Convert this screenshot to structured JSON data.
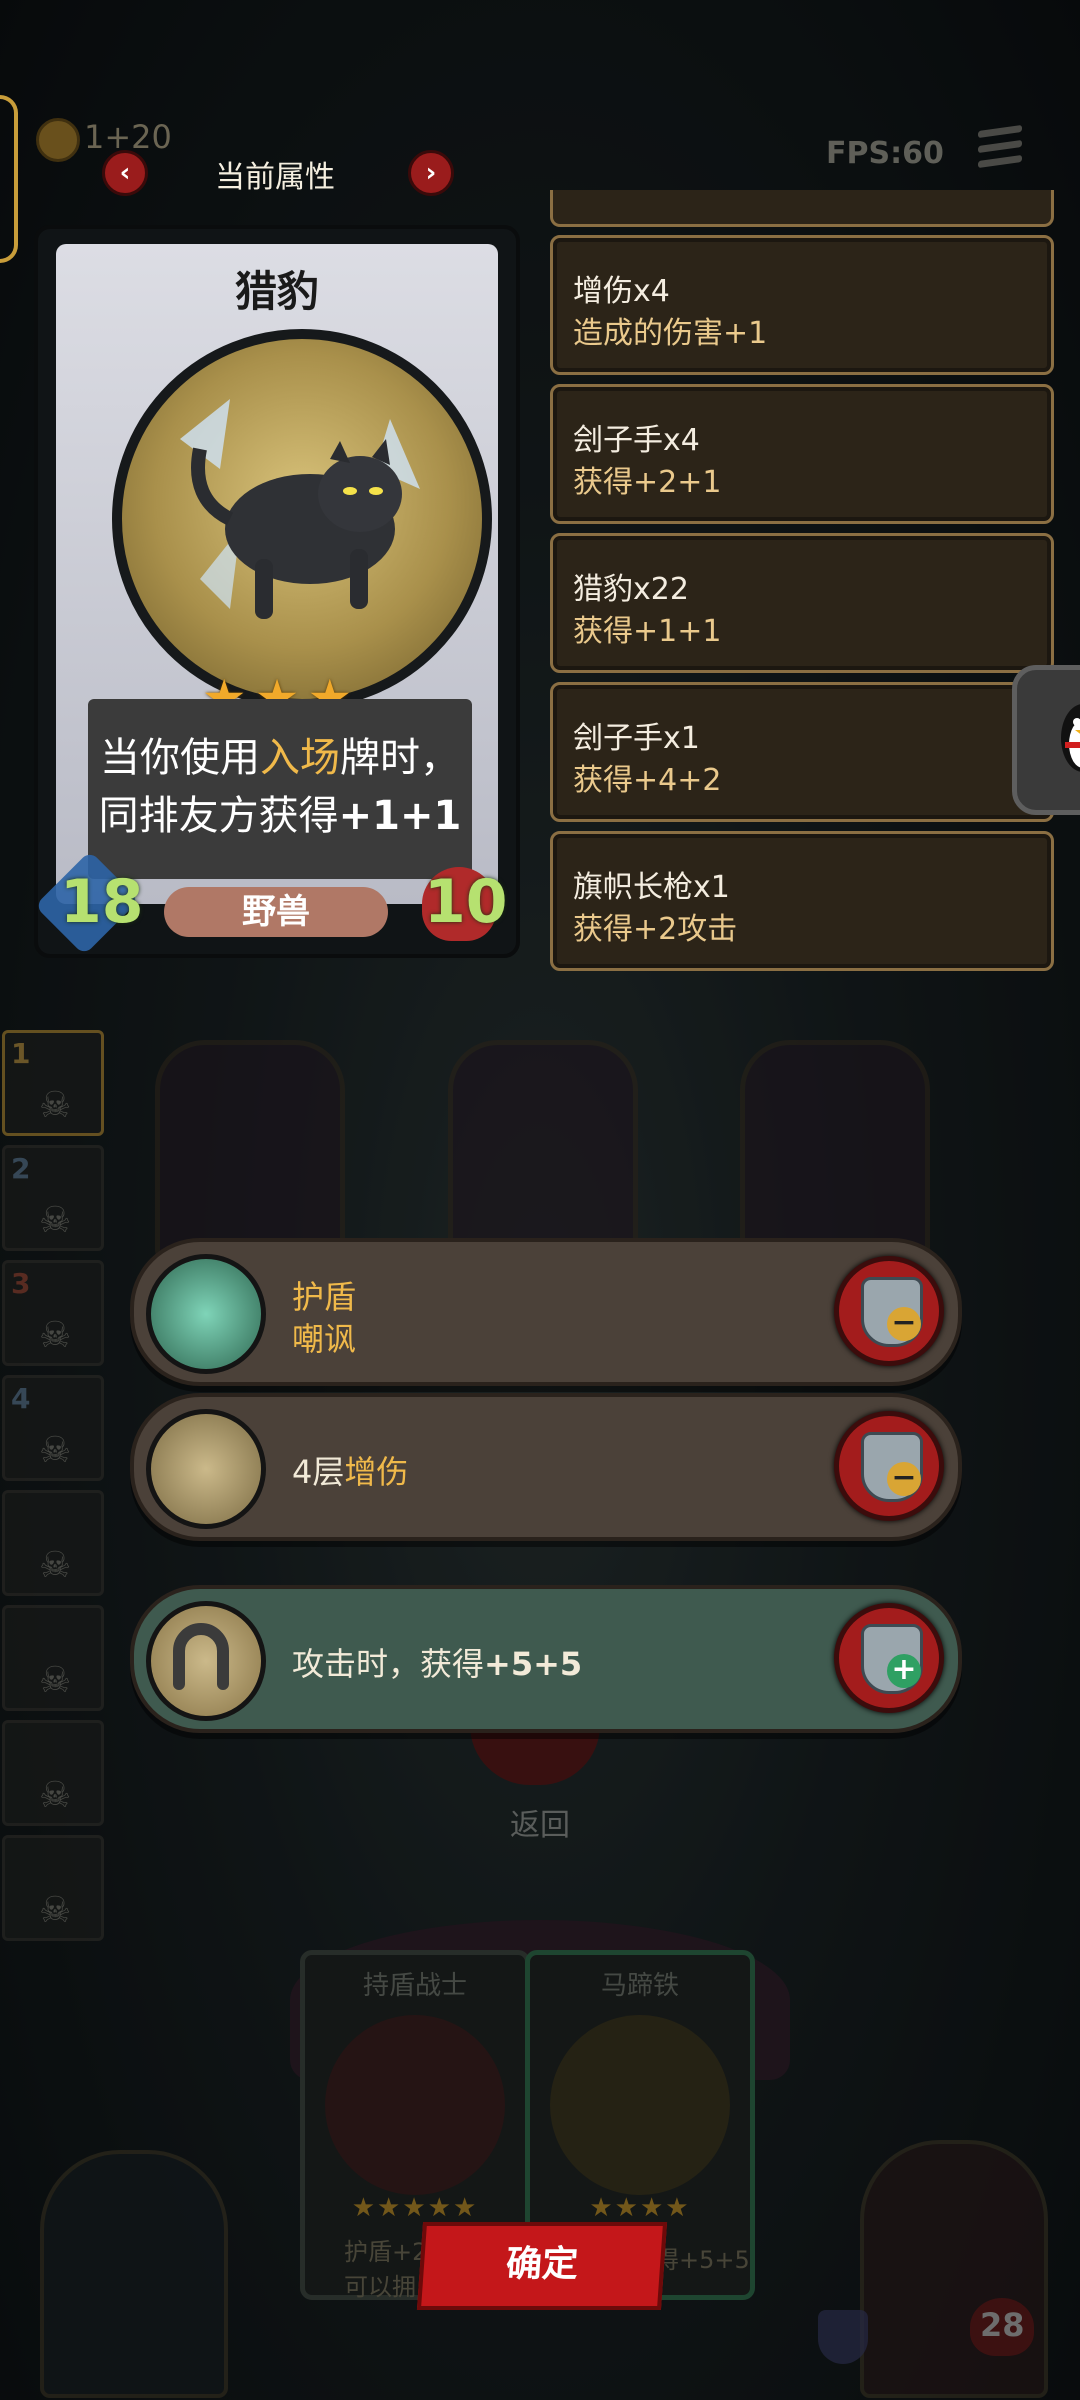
{
  "topbar": {
    "coin_text": "1+20",
    "fps": "FPS:60",
    "tab_title": "当前属性",
    "prev_glyph": "‹",
    "next_glyph": "›"
  },
  "hero": {
    "name": "猎豹",
    "stars": 3,
    "desc_line1_a": "当你使用",
    "desc_line1_kw": "入场",
    "desc_line1_b": "牌时，",
    "desc_line2_a": "同排友方获得",
    "desc_line2_b": "+1+1",
    "attack": "18",
    "health": "10",
    "type": "野兽"
  },
  "attributes": [
    {
      "title": "增伤x4",
      "sub": "造成的伤害+1"
    },
    {
      "title": "刽子手x4",
      "sub": "获得+2+1"
    },
    {
      "title": "猎豹x22",
      "sub": "获得+1+1"
    },
    {
      "title": "刽子手x1",
      "sub": "获得+4+2"
    },
    {
      "title": "旗帜长枪x1",
      "sub": "获得+2攻击"
    }
  ],
  "slots": [
    "1",
    "2",
    "3",
    "4",
    "",
    "",
    "",
    ""
  ],
  "effects": [
    {
      "line1": "护盾",
      "line2": "嘲讽",
      "button": "−",
      "icon": "shield-taunt-icon"
    },
    {
      "prefix": "4层",
      "kw": "增伤",
      "button": "−",
      "icon": "wings-icon"
    },
    {
      "text_a": "攻击时，获得",
      "text_b": "+5+5",
      "button": "+",
      "icon": "horseshoe-icon"
    }
  ],
  "return_label": "返回",
  "bottom_cards": [
    {
      "title": "持盾战士",
      "stars": "★★★★★"
    },
    {
      "title": "马蹄铁",
      "stars": "★★★★"
    }
  ],
  "bottom_text_left": "护盾+2",
  "bottom_text_left2": "可以拥",
  "bottom_text_right": "得+5+5",
  "confirm_label": "确定",
  "player_hp": "28",
  "colors": {
    "accent_gold": "#f0b94a",
    "button_red": "#a31c1c",
    "border_brown": "#8b6f43"
  }
}
